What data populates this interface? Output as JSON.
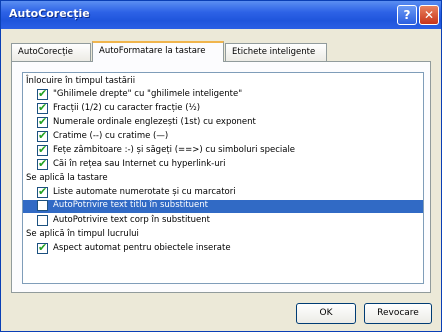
{
  "window": {
    "title": "AutoCorecție"
  },
  "titlebar": {
    "help_label": "?",
    "close_label": "✕"
  },
  "tabs": [
    {
      "label": "AutoCorecție"
    },
    {
      "label": "AutoFormatare la tastare"
    },
    {
      "label": "Etichete inteligente"
    }
  ],
  "sections": [
    {
      "heading": "Înlocuire în timpul tastării",
      "items": [
        {
          "label": "\"Ghilimele drepte\" cu \"ghilimele inteligente\"",
          "checked": true
        },
        {
          "label": "Fracții (1/2) cu caracter fracție (½)",
          "checked": true
        },
        {
          "label": "Numerale ordinale englezești (1st) cu exponent",
          "checked": true
        },
        {
          "label": "Cratime (--) cu cratime (—)",
          "checked": true
        },
        {
          "label": "Fețe zâmbitoare :-) și săgeți (==>) cu simboluri speciale",
          "checked": true
        },
        {
          "label": "Căi în rețea sau Internet cu hyperlink-uri",
          "checked": true
        }
      ]
    },
    {
      "heading": "Se aplică la tastare",
      "items": [
        {
          "label": "Liste automate numerotate și cu marcatori",
          "checked": true
        },
        {
          "label": "AutoPotrivire text titlu în substituent",
          "checked": false,
          "selected": true
        },
        {
          "label": "AutoPotrivire text corp în substituent",
          "checked": false
        }
      ]
    },
    {
      "heading": "Se aplică în timpul lucrului",
      "items": [
        {
          "label": "Aspect automat pentru obiectele inserate",
          "checked": true
        }
      ]
    }
  ],
  "buttons": {
    "ok": "OK",
    "cancel": "Revocare"
  },
  "check_glyph": "✔"
}
